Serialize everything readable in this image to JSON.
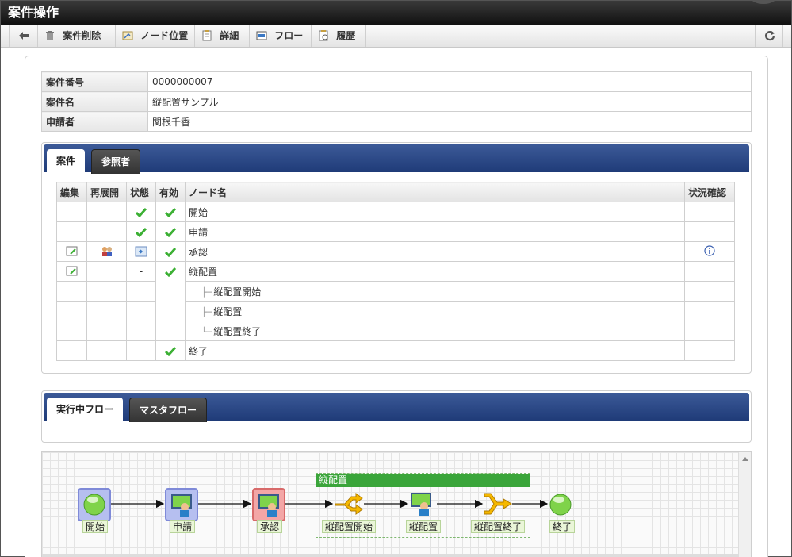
{
  "window": {
    "title": "案件操作"
  },
  "toolbar": {
    "back_label": "",
    "delete_label": "案件削除",
    "node_position_label": "ノード位置",
    "detail_label": "詳細",
    "flow_label": "フロー",
    "history_label": "履歴"
  },
  "info": {
    "rows": [
      {
        "label": "案件番号",
        "value": "0000000007"
      },
      {
        "label": "案件名",
        "value": "縦配置サンプル"
      },
      {
        "label": "申請者",
        "value": "関根千香"
      }
    ]
  },
  "case_tabs": {
    "active": "案件",
    "other": "参照者"
  },
  "nodes_table": {
    "headers": {
      "edit": "編集",
      "redeploy": "再展開",
      "state": "状態",
      "enabled": "有効",
      "node_name": "ノード名",
      "status_check": "状況確認"
    },
    "rows": [
      {
        "name": "開始"
      },
      {
        "name": "申請"
      },
      {
        "name": "承認"
      },
      {
        "name": "縦配置",
        "state_text": "-"
      },
      {
        "name": "縦配置開始"
      },
      {
        "name": "縦配置"
      },
      {
        "name": "縦配置終了"
      },
      {
        "name": "終了"
      }
    ]
  },
  "flow_tabs": {
    "active": "実行中フロー",
    "other": "マスタフロー"
  },
  "flow": {
    "group_label": "縦配置",
    "nodes": [
      "開始",
      "申請",
      "承認",
      "縦配置開始",
      "縦配置",
      "縦配置終了",
      "終了"
    ]
  },
  "colors": {
    "accent": "#2b4a8a",
    "check": "#3cb034",
    "flow_label_bg": "#eaf6d8",
    "group_header": "#3aa53a"
  }
}
